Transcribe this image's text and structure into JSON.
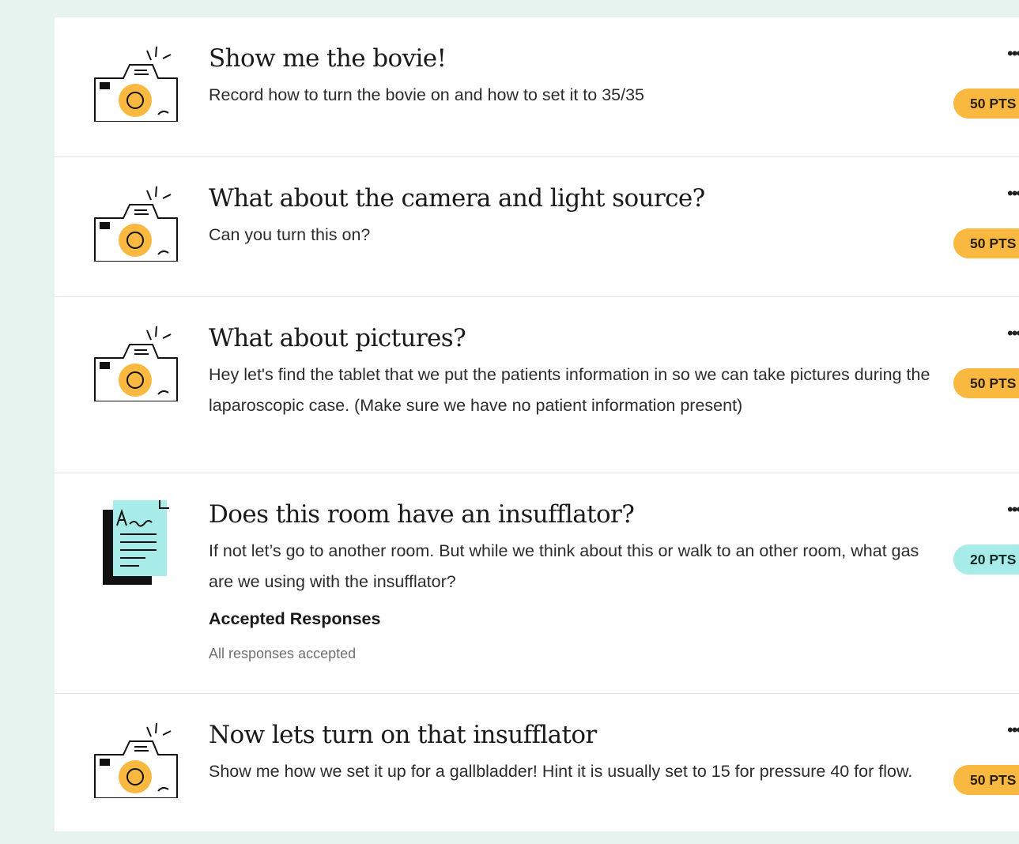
{
  "tasks": [
    {
      "icon": "camera-icon",
      "title": "Show me the bovie!",
      "description": "Record how to turn the bovie on and how to set it to 35/35",
      "points": "50 PTS"
    },
    {
      "icon": "camera-icon",
      "title": "What about the camera and light source?",
      "description": "Can you turn this on?",
      "points": "50 PTS"
    },
    {
      "icon": "camera-icon",
      "title": "What about pictures?",
      "description": "Hey let's find the tablet that we put the patients information in so we can take pictures during the laparoscopic case. (Make sure we have no patient information present)",
      "points": "50 PTS"
    },
    {
      "icon": "text-response-icon",
      "title": "Does this room have an insufflator?",
      "description": "If not let’s go to another room. But while we think about this or walk to an other room, what gas are we using with the insufflator?",
      "accepted_heading": "Accepted Responses",
      "accepted_value": "All responses accepted",
      "points": "20 PTS"
    },
    {
      "icon": "camera-icon",
      "title": "Now lets turn on that insufflator",
      "description": "Show me how we set it up for a gallbladder! Hint it is usually set to 15 for pressure 40 for flow.",
      "points": "50 PTS"
    }
  ],
  "menu_glyph": "•••",
  "colors": {
    "background": "#e6f3ee",
    "points_orange": "#f9b940",
    "points_teal": "#a8ece9",
    "icon_accent_orange": "#f9b940",
    "icon_accent_teal": "#a8ece9"
  }
}
